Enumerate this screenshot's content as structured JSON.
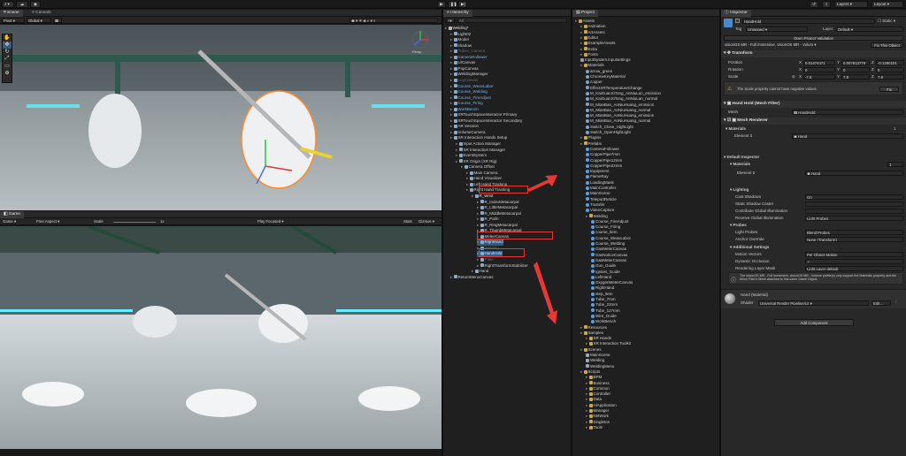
{
  "toolbar": {
    "account": "J",
    "play_icon": "play-icon",
    "pause_icon": "pause-icon",
    "step_icon": "step-icon",
    "layers": "Layers",
    "layout": "Layout"
  },
  "scene": {
    "tabs": [
      "Scene",
      "Console"
    ],
    "pivot": "Pivot",
    "global": "Global",
    "persp_label": "Persp",
    "toggle_2d": "2D"
  },
  "game": {
    "tab": "Game",
    "display": "Game",
    "aspect": "Free Aspect",
    "scale_label": "Scale",
    "scale_value": "1x",
    "play_mode": "Play Focused",
    "stats": "Stats",
    "gizmos": "Gizmos"
  },
  "hierarchy": {
    "tab": "Hierarchy",
    "search_placeholder": "All",
    "items": [
      {
        "text": "Welding*",
        "indent": 0,
        "hl": false,
        "color": "#e0e0e0"
      },
      {
        "text": "Light02",
        "indent": 1,
        "color": "#cfcfcf"
      },
      {
        "text": "Model",
        "indent": 1,
        "color": "#cfcfcf"
      },
      {
        "text": "shadow",
        "indent": 1,
        "color": "#cfcfcf"
      },
      {
        "text": "Tubes_Camera",
        "indent": 1,
        "color": "#6a6a6a"
      },
      {
        "text": "CameraFollower",
        "indent": 1,
        "color": "#7cb7ef"
      },
      {
        "text": "UICanvas",
        "indent": 1,
        "color": "#cfcfcf"
      },
      {
        "text": "PopCanvas",
        "indent": 1,
        "color": "#cfcfcf"
      },
      {
        "text": "WeldingManager",
        "indent": 1,
        "color": "#cfcfcf"
      },
      {
        "text": "LogCanvas",
        "indent": 1,
        "color": "#6a6a6a"
      },
      {
        "text": "Course_WeavLabor",
        "indent": 1,
        "color": "#7cb7ef"
      },
      {
        "text": "Course_Welding",
        "indent": 1,
        "color": "#7cb7ef"
      },
      {
        "text": "Course_FireAdjust",
        "indent": 1,
        "color": "#7cb7ef"
      },
      {
        "text": "Course_Firing",
        "indent": 1,
        "color": "#7cb7ef"
      },
      {
        "text": "WorkBench",
        "indent": 1,
        "color": "#7cb7ef"
      },
      {
        "text": "XRTouchSpaceInteractor Primary",
        "indent": 1,
        "color": "#cfcfcf"
      },
      {
        "text": "XRTouchSpaceInteractor Secondary",
        "indent": 1,
        "color": "#cfcfcf"
      },
      {
        "text": "AR Session",
        "indent": 1,
        "color": "#cfcfcf"
      },
      {
        "text": "VolumeCamera",
        "indent": 1,
        "color": "#cfcfcf"
      },
      {
        "text": "XR Interaction Hands Setup",
        "indent": 1,
        "color": "#cfcfcf"
      },
      {
        "text": "Input Action Manager",
        "indent": 2,
        "color": "#cfcfcf"
      },
      {
        "text": "XR Interaction Manager",
        "indent": 2,
        "color": "#cfcfcf"
      },
      {
        "text": "EventSystem",
        "indent": 2,
        "color": "#cfcfcf"
      },
      {
        "text": "XR Origin (XR Rig)",
        "indent": 2,
        "color": "#cfcfcf"
      },
      {
        "text": "Camera Offset",
        "indent": 3,
        "color": "#cfcfcf"
      },
      {
        "text": "Main Camera",
        "indent": 4,
        "color": "#cfcfcf"
      },
      {
        "text": "Hand Visualizer",
        "indent": 4,
        "color": "#cfcfcf"
      },
      {
        "text": "Left Hand Tracking",
        "indent": 4,
        "color": "#cfcfcf"
      },
      {
        "text": "Right Hand Tracking",
        "indent": 4,
        "color": "#cfcfcf"
      },
      {
        "text": "R_Wrist",
        "indent": 5,
        "color": "#e0e0e0"
      },
      {
        "text": "R_IndexMetacarpal",
        "indent": 6,
        "color": "#cfcfcf"
      },
      {
        "text": "R_LittleMetacarpal",
        "indent": 6,
        "color": "#cfcfcf"
      },
      {
        "text": "R_MiddleMetacarpal",
        "indent": 6,
        "color": "#cfcfcf"
      },
      {
        "text": "R_Palm",
        "indent": 6,
        "color": "#cfcfcf"
      },
      {
        "text": "R_RingMetacarpal",
        "indent": 6,
        "color": "#cfcfcf"
      },
      {
        "text": "R_ThumbMetacarpal",
        "indent": 6,
        "color": "#cfcfcf"
      },
      {
        "text": "MeleeCanvas",
        "indent": 6,
        "color": "#cfcfcf"
      },
      {
        "text": "RightHand",
        "indent": 6,
        "color": "#e0e0e0",
        "hl": true
      },
      {
        "text": "Welding",
        "indent": 6,
        "color": "#6a6a6a"
      },
      {
        "text": "HandHold",
        "indent": 6,
        "color": "#e0e0e0",
        "hl": true
      },
      {
        "text": "Poke",
        "indent": 6,
        "color": "#6a6a6a"
      },
      {
        "text": "RightTransformStabilizer",
        "indent": 6,
        "color": "#cfcfcf"
      },
      {
        "text": "Hand",
        "indent": 5,
        "color": "#cfcfcf"
      },
      {
        "text": "ReturnMenuCanvas",
        "indent": 1,
        "color": "#cfcfcf"
      }
    ]
  },
  "project": {
    "tab": "Project",
    "folders": [
      {
        "text": "Assets",
        "indent": 0,
        "type": "folder"
      },
      {
        "text": "Animation",
        "indent": 1,
        "type": "folder"
      },
      {
        "text": "ArtAssets",
        "indent": 1,
        "type": "folder"
      },
      {
        "text": "Editor",
        "indent": 1,
        "type": "folder"
      },
      {
        "text": "ExampleAssets",
        "indent": 1,
        "type": "folder"
      },
      {
        "text": "Extra",
        "indent": 1,
        "type": "folder"
      },
      {
        "text": "Fonts",
        "indent": 1,
        "type": "folder"
      },
      {
        "text": "InputSystem.inputsettings",
        "indent": 1,
        "type": "file"
      },
      {
        "text": "Materials",
        "indent": 1,
        "type": "folder"
      },
      {
        "text": "arrow_green",
        "indent": 2,
        "type": "mat"
      },
      {
        "text": "ChromeKeyMaterial",
        "indent": 2,
        "type": "mat"
      },
      {
        "text": "copper",
        "indent": 2,
        "type": "mat"
      },
      {
        "text": "EffectXRTemperatureChange",
        "indent": 2,
        "type": "mat"
      },
      {
        "text": "M_KaiGuanXiTong_AnNiuLan_emission",
        "indent": 2,
        "type": "mat"
      },
      {
        "text": "M_KaiGuanXiTong_AnNiuLan_normal",
        "indent": 2,
        "type": "mat"
      },
      {
        "text": "M_MianBan_AnNiuHuang_emission",
        "indent": 2,
        "type": "mat"
      },
      {
        "text": "M_MianBan_AnNiuHuang_normal",
        "indent": 2,
        "type": "mat"
      },
      {
        "text": "M_MianBan_AnNiuHuang_emission",
        "indent": 2,
        "type": "mat"
      },
      {
        "text": "M_MianBan_AnNiuHuang_normal",
        "indent": 2,
        "type": "mat"
      },
      {
        "text": "Switch_Close_HighLight",
        "indent": 2,
        "type": "mat"
      },
      {
        "text": "Switch_OpenHighLight",
        "indent": 2,
        "type": "mat"
      },
      {
        "text": "Plugins",
        "indent": 1,
        "type": "folder"
      },
      {
        "text": "Prefabs",
        "indent": 1,
        "type": "folder"
      },
      {
        "text": "CameraFollower",
        "indent": 2,
        "type": "prefab"
      },
      {
        "text": "CopperPipe7mm",
        "indent": 2,
        "type": "prefab"
      },
      {
        "text": "CopperPipe12mm",
        "indent": 2,
        "type": "prefab"
      },
      {
        "text": "CopperPipe22mm",
        "indent": 2,
        "type": "prefab"
      },
      {
        "text": "Equipment",
        "indent": 2,
        "type": "prefab"
      },
      {
        "text": "FlameRay",
        "indent": 2,
        "type": "prefab"
      },
      {
        "text": "LoadingMask",
        "indent": 2,
        "type": "prefab"
      },
      {
        "text": "MainController",
        "indent": 2,
        "type": "prefab"
      },
      {
        "text": "MainScene",
        "indent": 2,
        "type": "prefab"
      },
      {
        "text": "TeleportReticle",
        "indent": 2,
        "type": "prefab"
      },
      {
        "text": "Transfer",
        "indent": 2,
        "type": "prefab"
      },
      {
        "text": "VideoCapture",
        "indent": 2,
        "type": "prefab"
      },
      {
        "text": "Welding",
        "indent": 2,
        "type": "folder"
      },
      {
        "text": "Course_FireAdjust",
        "indent": 3,
        "type": "prefab"
      },
      {
        "text": "Course_Firing",
        "indent": 3,
        "type": "prefab"
      },
      {
        "text": "course_item",
        "indent": 3,
        "type": "prefab"
      },
      {
        "text": "Course_WeavLabor",
        "indent": 3,
        "type": "prefab"
      },
      {
        "text": "Course_Welding",
        "indent": 3,
        "type": "prefab"
      },
      {
        "text": "GasMeterCanvas",
        "indent": 3,
        "type": "prefab"
      },
      {
        "text": "GasNoticeCanvas",
        "indent": 3,
        "type": "prefab"
      },
      {
        "text": "GasMeterCanvas",
        "indent": 3,
        "type": "prefab"
      },
      {
        "text": "Gun_Guide",
        "indent": 3,
        "type": "prefab"
      },
      {
        "text": "Ignites_Guide",
        "indent": 3,
        "type": "prefab"
      },
      {
        "text": "LeftHand",
        "indent": 3,
        "type": "prefab"
      },
      {
        "text": "OxygenMeterCanvas",
        "indent": 3,
        "type": "prefab"
      },
      {
        "text": "RightHand",
        "indent": 3,
        "type": "prefab"
      },
      {
        "text": "step_item",
        "indent": 3,
        "type": "prefab"
      },
      {
        "text": "Tube_7mm",
        "indent": 3,
        "type": "prefab"
      },
      {
        "text": "Tube_22mm",
        "indent": 3,
        "type": "prefab"
      },
      {
        "text": "Tube_127mm",
        "indent": 3,
        "type": "prefab"
      },
      {
        "text": "Wire_Guide",
        "indent": 3,
        "type": "prefab"
      },
      {
        "text": "WorkBench",
        "indent": 3,
        "type": "prefab"
      },
      {
        "text": "Resources",
        "indent": 1,
        "type": "folder"
      },
      {
        "text": "Samples",
        "indent": 1,
        "type": "folder"
      },
      {
        "text": "XR Hands",
        "indent": 2,
        "type": "folder"
      },
      {
        "text": "XR Interaction Toolkit",
        "indent": 2,
        "type": "folder"
      },
      {
        "text": "Scenes",
        "indent": 1,
        "type": "folder"
      },
      {
        "text": "MainScene",
        "indent": 2,
        "type": "scene"
      },
      {
        "text": "Welding",
        "indent": 2,
        "type": "scene"
      },
      {
        "text": "WeldingMenu",
        "indent": 2,
        "type": "scene"
      },
      {
        "text": "Scripts",
        "indent": 1,
        "type": "folder"
      },
      {
        "text": "BPM",
        "indent": 2,
        "type": "folder"
      },
      {
        "text": "Business",
        "indent": 2,
        "type": "folder"
      },
      {
        "text": "Common",
        "indent": 2,
        "type": "folder"
      },
      {
        "text": "Controller",
        "indent": 2,
        "type": "folder"
      },
      {
        "text": "Data",
        "indent": 2,
        "type": "folder"
      },
      {
        "text": "HiApplication",
        "indent": 2,
        "type": "folder"
      },
      {
        "text": "Manager",
        "indent": 2,
        "type": "folder"
      },
      {
        "text": "NetWork",
        "indent": 2,
        "type": "folder"
      },
      {
        "text": "Singleton",
        "indent": 2,
        "type": "folder"
      },
      {
        "text": "Tools",
        "indent": 2,
        "type": "folder"
      }
    ]
  },
  "inspector": {
    "tab": "Inspector",
    "name": "HandHold",
    "static": "Static",
    "tag_label": "Tag",
    "tag": "Untagged",
    "layer_label": "Layer",
    "layer": "Default",
    "prefab_open": "Open Project Validation",
    "visionos": "visionOS MR - Full Immersive, visionOS MR - Volum ▾",
    "fix_this": "Fix This Object",
    "transform": {
      "title": "Transform",
      "pos_label": "Position",
      "rot_label": "Rotation",
      "scale_label": "Scale",
      "pos": [
        "0.01474471",
        "0.007813778",
        "-0.1290101"
      ],
      "rot": [
        "0",
        "0",
        "0"
      ],
      "scale": [
        "-7.8",
        "7.8",
        "7.8"
      ],
      "warning": "The Scale property cannot have negative values.",
      "fix": "Fix"
    },
    "mesh_filter": {
      "title": "Hand Hold (Mesh Filter)",
      "mesh_label": "Mesh",
      "mesh": "HandHold"
    },
    "mesh_renderer": {
      "title": "Mesh Renderer",
      "materials": "Materials",
      "count": "1",
      "element0": "Element 0",
      "element0_val": "Hand"
    },
    "default_inspector": {
      "title": "Default Inspector",
      "materials": "Materials",
      "count": "1",
      "element0": "Element 0",
      "element0_val": "Hand"
    },
    "lighting": {
      "title": "Lighting",
      "rows": [
        [
          "Cast Shadows",
          "On"
        ],
        [
          "Static Shadow Caster",
          ""
        ],
        [
          "Contribute Global Illumination",
          ""
        ],
        [
          "Receive Global Illumination",
          "Light Probes"
        ]
      ]
    },
    "probes": {
      "title": "Probes",
      "rows": [
        [
          "Light Probes",
          "Blend Probes"
        ],
        [
          "Anchor Override",
          "None (Transform)"
        ]
      ]
    },
    "additional": {
      "title": "Additional Settings",
      "rows": [
        [
          "Motion Vectors",
          "Per Object Motion"
        ],
        [
          "Dynamic Occlusion",
          "✓"
        ],
        [
          "Rendering Layer Mask",
          "Light Layer default"
        ]
      ]
    },
    "info": "The visionOS MR - Full Immersive, visionOS MR - Volume profile(s) only support the Materials property and the Mesh Filter's Mesh attached to this same Game Object.",
    "material": {
      "title": "Hand (Material)",
      "shader_label": "Shader",
      "shader": "Universal Render Pipeline/Lit",
      "edit": "Edit..."
    },
    "add_component": "Add Component"
  },
  "colors": {
    "accent": "#2c5d87",
    "red": "#e53935",
    "bg": "#191919"
  }
}
